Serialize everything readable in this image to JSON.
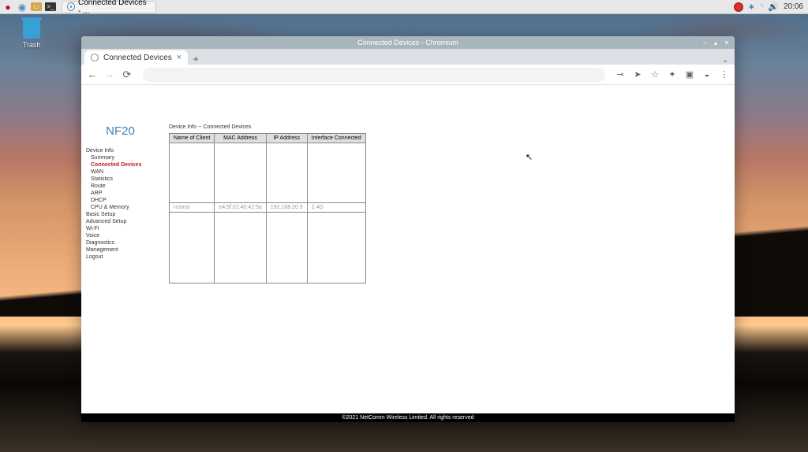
{
  "panel": {
    "task_title": "Connected Devices - ...",
    "clock": "20:06"
  },
  "trash": {
    "label": "Trash"
  },
  "window": {
    "title": "Connected Devices - Chromium",
    "tab_label": "Connected Devices",
    "controls": {
      "min": "−",
      "max": "▴",
      "close": "✕"
    }
  },
  "router": {
    "logo": "NF20",
    "nav": {
      "device_info": "Device Info",
      "summary": "Summary",
      "connected_devices": "Connected Devices",
      "wan": "WAN",
      "statistics": "Statistics",
      "route": "Route",
      "arp": "ARP",
      "dhcp": "DHCP",
      "cpu_memory": "CPU & Memory",
      "basic_setup": "Basic Setup",
      "advanced_setup": "Advanced Setup",
      "wifi": "Wi-Fi",
      "voice": "Voice",
      "diagnostics": "Diagnostics",
      "management": "Management",
      "logout": "Logout"
    },
    "breadcrumb": "Device Info -- Connected Devices",
    "headers": {
      "c1": "Name of Client",
      "c2": "MAC Address",
      "c3": "IP Address",
      "c4": "Interface Connected"
    },
    "rows": [
      {
        "name": "rnsmsi",
        "mac": "e4:5f:01:40:42:5a",
        "ip": "192.168.20.9",
        "iface": "2.4G"
      }
    ],
    "footer": "©2021 NetComm Wireless Limited. All rights reserved"
  }
}
